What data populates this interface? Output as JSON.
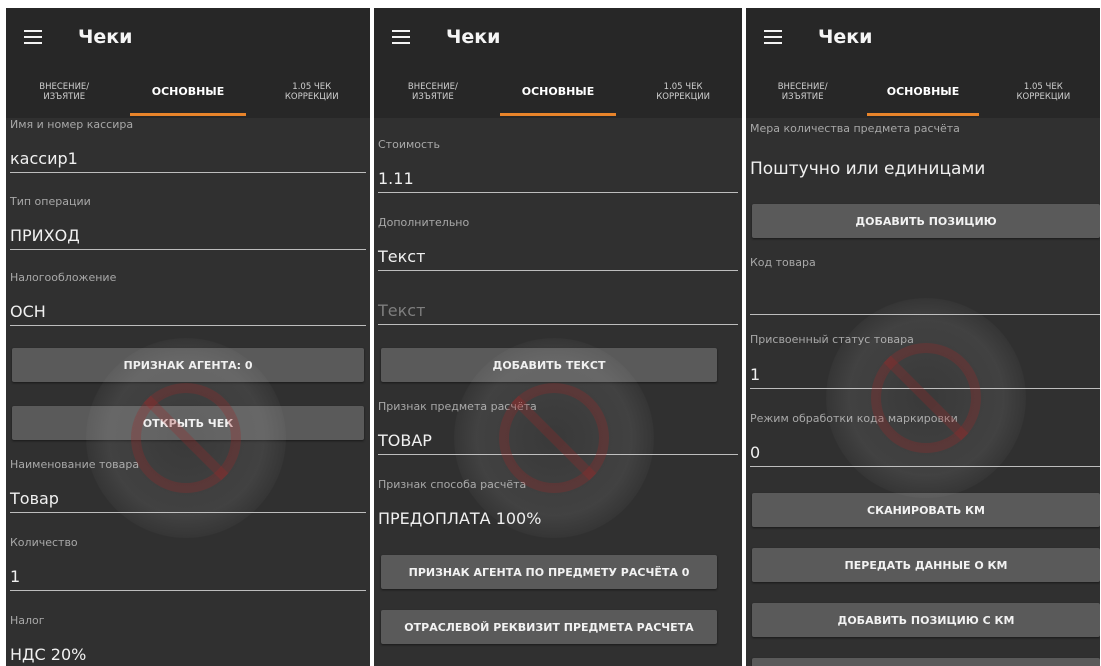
{
  "app": {
    "title": "Чеки"
  },
  "tabs": {
    "deposit": "ВНЕСЕНИЕ/\nИЗЪЯТИЕ",
    "main": "ОСНОВНЫЕ",
    "correction": "1.05 ЧЕК\nКОРРЕКЦИИ"
  },
  "screen1": {
    "cashier_label": "Имя и номер кассира",
    "cashier_value": "кассир1",
    "operation_label": "Тип операции",
    "operation_value": "ПРИХОД",
    "tax_system_label": "Налогообложение",
    "tax_system_value": "ОСН",
    "agent_button": "ПРИЗНАК АГЕНТА: 0",
    "open_check_button": "ОТКРЫТЬ ЧЕК",
    "product_name_label": "Наименование товара",
    "product_name_value": "Товар",
    "quantity_label": "Количество",
    "quantity_value": "1",
    "vat_label": "Налог",
    "vat_value": "НДС 20%"
  },
  "screen2": {
    "price_label": "Стоимость",
    "price_value": "1.11",
    "extra_label": "Дополнительно",
    "extra_value": "Текст",
    "extra_text_placeholder": "Текст",
    "add_text_button": "ДОБАВИТЬ ТЕКСТ",
    "subject_label": "Признак предмета расчёта",
    "subject_value": "ТОВАР",
    "payment_method_label": "Признак способа расчёта",
    "payment_method_value": "ПРЕДОПЛАТА 100%",
    "agent_subject_button": "ПРИЗНАК АГЕНТА ПО ПРЕДМЕТУ РАСЧЁТА 0",
    "industry_button": "ОТРАСЛЕВОЙ РЕКВИЗИТ ПРЕДМЕТА РАСЧЕТА"
  },
  "screen3": {
    "measure_label": "Мера количества предмета расчёта",
    "measure_value": "Поштучно или единицами",
    "add_position_button": "ДОБАВИТЬ ПОЗИЦИЮ",
    "product_code_label": "Код товара",
    "product_code_value": "",
    "status_label": "Присвоенный статус товара",
    "status_value": "1",
    "marking_mode_label": "Режим обработки кода маркировки",
    "marking_mode_value": "0",
    "scan_km_button": "СКАНИРОВАТЬ КМ",
    "send_km_button": "ПЕРЕДАТЬ ДАННЫЕ О КМ",
    "add_position_km_button": "ДОБАВИТЬ ПОЗИЦИЮ С КМ"
  }
}
